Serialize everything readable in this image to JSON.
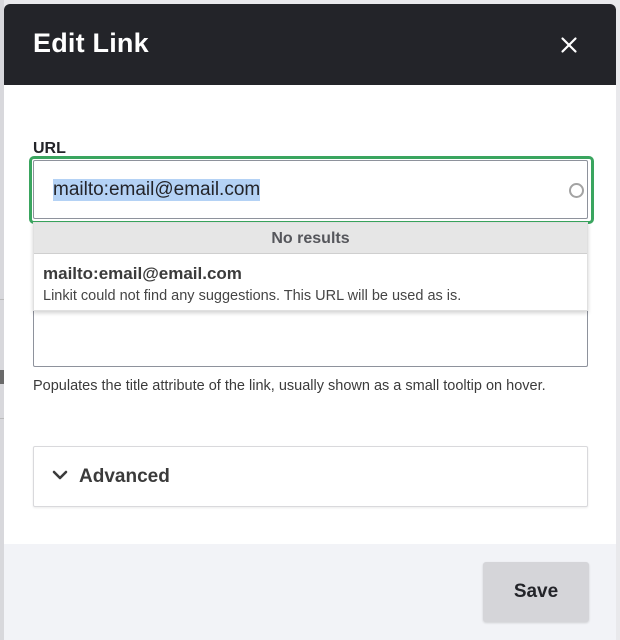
{
  "dialog": {
    "title": "Edit Link",
    "close_icon": "close-icon"
  },
  "url_field": {
    "label": "URL",
    "value": "mailto:email@email.com",
    "throbber_icon": "loading-throbber-icon",
    "focus_color": "#3aa55f"
  },
  "autocomplete": {
    "no_results": "No results",
    "suggestion": {
      "title": "mailto:email@email.com",
      "description": "Linkit could not find any suggestions. This URL will be used as is."
    }
  },
  "title_field": {
    "value": "",
    "description": "Populates the title attribute of the link, usually shown as a small tooltip on hover."
  },
  "advanced": {
    "label": "Advanced",
    "icon": "chevron-down-icon"
  },
  "footer": {
    "save_label": "Save"
  },
  "colors": {
    "header_bg": "#232429",
    "footer_bg": "#f2f3f7",
    "button_bg": "#d5d5d9",
    "selection": "#b4d2f5"
  }
}
